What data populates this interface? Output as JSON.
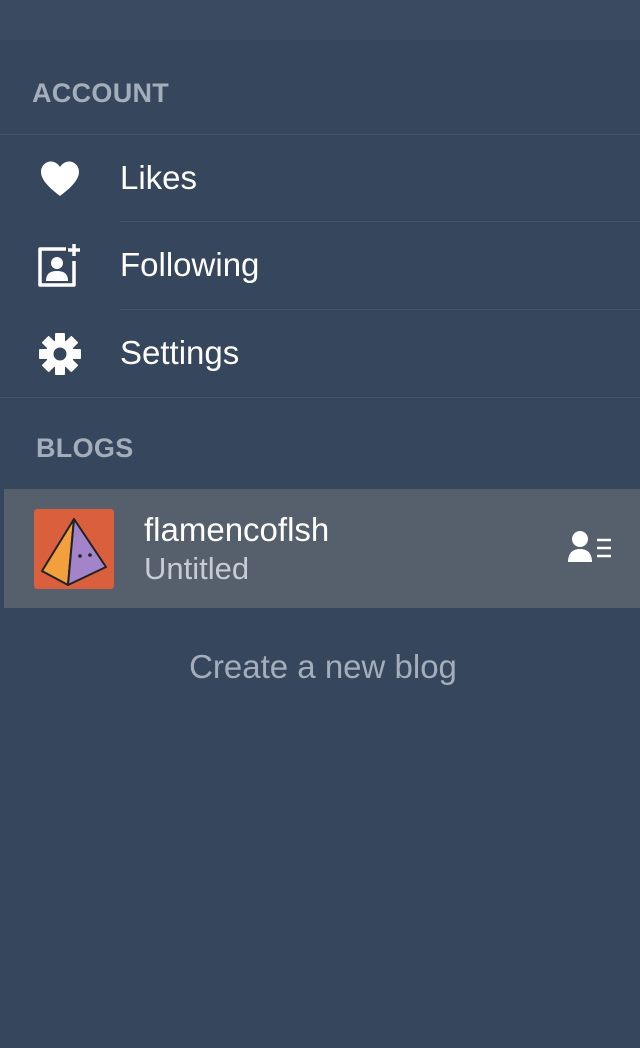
{
  "colors": {
    "background": "#36465d",
    "section_header": "#a4adba",
    "selected_row": "#565f6c",
    "avatar_bg": "#d95f3d"
  },
  "account": {
    "header": "ACCOUNT",
    "items": [
      {
        "label": "Likes",
        "icon": "heart-icon"
      },
      {
        "label": "Following",
        "icon": "add-contact-icon"
      },
      {
        "label": "Settings",
        "icon": "gear-icon"
      }
    ]
  },
  "blogs": {
    "header": "BLOGS",
    "items": [
      {
        "name": "flamencoflsh",
        "title": "Untitled",
        "avatar": "pyramid-avatar",
        "action_icon": "blog-members-icon"
      }
    ],
    "create_label": "Create a new blog"
  }
}
